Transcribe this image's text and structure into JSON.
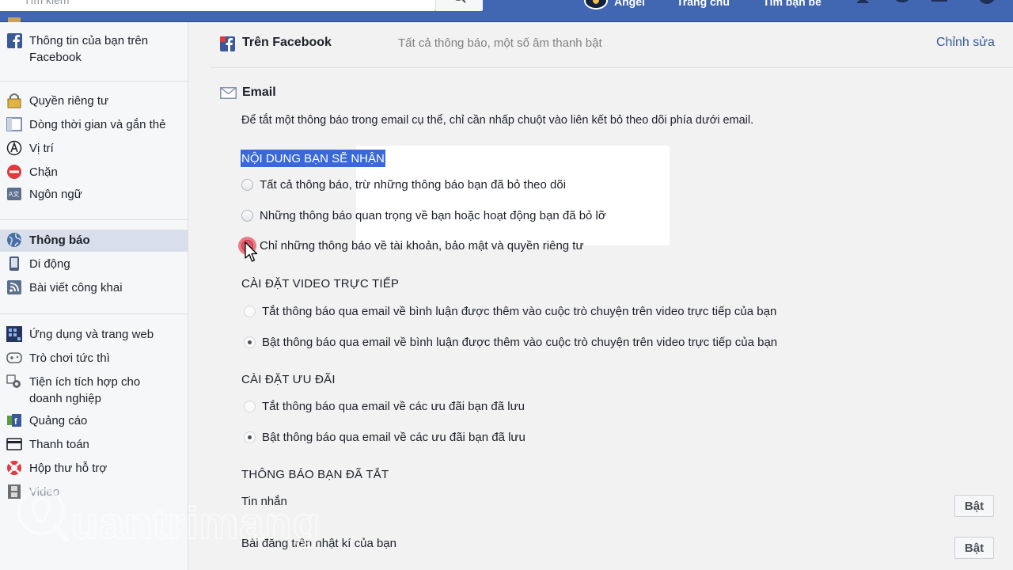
{
  "topbar": {
    "search_placeholder": "Tìm kiếm",
    "user_name": "Angel",
    "home": "Trang chủ",
    "find_friends": "Tìm bạn bè"
  },
  "sidebar": {
    "group1": [
      {
        "label": "Thông tin của bạn trên Facebook",
        "icon": "facebook-icon"
      }
    ],
    "group2": [
      {
        "label": "Quyền riêng tư",
        "icon": "lock-icon"
      },
      {
        "label": "Dòng thời gian và gắn thẻ",
        "icon": "timeline-icon"
      },
      {
        "label": "Vị trí",
        "icon": "location-icon"
      },
      {
        "label": "Chặn",
        "icon": "block-icon"
      },
      {
        "label": "Ngôn ngữ",
        "icon": "language-icon"
      }
    ],
    "group3": [
      {
        "label": "Thông báo",
        "icon": "globe-icon",
        "active": true
      },
      {
        "label": "Di động",
        "icon": "mobile-icon"
      },
      {
        "label": "Bài viết công khai",
        "icon": "rss-icon"
      }
    ],
    "group4": [
      {
        "label": "Ứng dụng và trang web",
        "icon": "apps-icon"
      },
      {
        "label": "Trò chơi tức thì",
        "icon": "gamepad-icon"
      },
      {
        "label": "Tiện ích tích hợp cho doanh nghiệp",
        "icon": "gear-icon"
      },
      {
        "label": "Quảng cáo",
        "icon": "ads-icon"
      },
      {
        "label": "Thanh toán",
        "icon": "card-icon"
      },
      {
        "label": "Hộp thư hỗ trợ",
        "icon": "lifebuoy-icon"
      },
      {
        "label": "Video",
        "icon": "film-icon"
      }
    ]
  },
  "on_facebook": {
    "title": "Trên Facebook",
    "description": "Tất cả thông báo, một số âm thanh bật",
    "edit": "Chỉnh sửa"
  },
  "email": {
    "title": "Email",
    "description": "Để tắt một thông báo trong email cụ thể, chỉ cần nhấp chuột vào liên kết bỏ theo dõi phía dưới email.",
    "content_heading": "NỘI DUNG BẠN SẼ NHẬN",
    "content_options": [
      "Tất cả thông báo, trừ những thông báo bạn đã bỏ theo dõi",
      "Những thông báo quan trọng về bạn hoặc hoạt động bạn đã bỏ lỡ",
      "Chỉ những thông báo về tài khoản, bảo mật và quyền riêng tư"
    ],
    "live_heading": "CÀI ĐẶT VIDEO TRỰC TIẾP",
    "live_options": [
      "Tắt thông báo qua email về bình luận được thêm vào cuộc trò chuyện trên video trực tiếp của bạn",
      "Bật thông báo qua email về bình luận được thêm vào cuộc trò chuyện trên video trực tiếp của bạn"
    ],
    "offers_heading": "CÀI ĐẶT ƯU ĐÃI",
    "offers_options": [
      "Tắt thông báo qua email về các ưu đãi bạn đã lưu",
      "Bật thông báo qua email về các ưu đãi bạn đã lưu"
    ],
    "muted_heading": "THÔNG BÁO BẠN ĐÃ TẮT",
    "muted_items": [
      {
        "label": "Tin nhắn",
        "button": "Bật"
      },
      {
        "label": "Bài đăng trên nhật kí của bạn",
        "button": "Bật"
      }
    ]
  },
  "watermark": "uantrimang",
  "colors": {
    "brand": "#4267b2",
    "link": "#365899",
    "highlight": "#3a69d6",
    "active_item": "#d8dfea"
  }
}
